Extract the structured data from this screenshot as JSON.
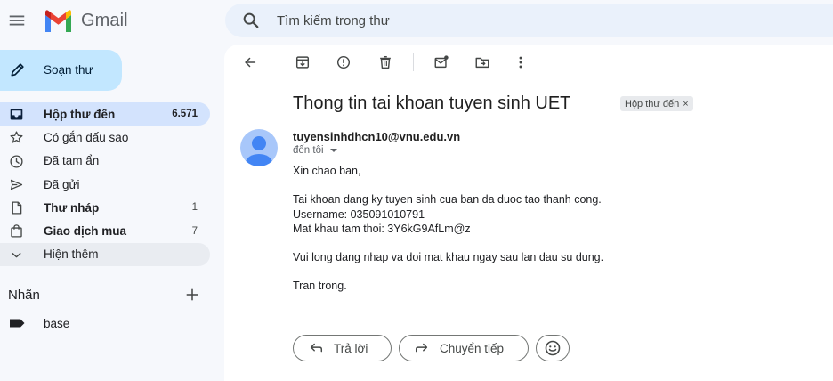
{
  "app": {
    "name": "Gmail"
  },
  "search": {
    "placeholder": "Tìm kiếm trong thư"
  },
  "compose": {
    "label": "Soạn thư"
  },
  "sidebar": {
    "items": [
      {
        "label": "Hộp thư đến",
        "count": "6.571",
        "icon": "inbox-icon"
      },
      {
        "label": "Có gắn dấu sao",
        "count": "",
        "icon": "star-icon"
      },
      {
        "label": "Đã tạm ẩn",
        "count": "",
        "icon": "clock-icon"
      },
      {
        "label": "Đã gửi",
        "count": "",
        "icon": "send-icon"
      },
      {
        "label": "Thư nháp",
        "count": "1",
        "icon": "draft-icon"
      },
      {
        "label": "Giao dịch mua",
        "count": "7",
        "icon": "shopping-bag-icon"
      },
      {
        "label": "Hiện thêm",
        "count": "",
        "icon": "chevron-down-icon"
      }
    ],
    "labels_title": "Nhãn",
    "labels": [
      {
        "name": "base"
      }
    ]
  },
  "email": {
    "subject": "Thong tin tai khoan tuyen sinh UET",
    "folder_chip": "Hộp thư đến",
    "chip_close": "×",
    "sender": "tuyensinhdhcn10@vnu.edu.vn",
    "recipient": "đến tôi",
    "body": [
      "Xin chao ban,",
      "Tai khoan dang ky tuyen sinh cua ban da duoc tao thanh cong.",
      "Username: 035091010791",
      "Mat khau tam thoi: 3Y6kG9AfLm@z",
      "Vui long dang nhap va doi mat khau ngay sau lan dau su dung.",
      "Tran trong."
    ]
  },
  "actions": {
    "reply": "Trả lời",
    "forward": "Chuyển tiếp"
  },
  "colors": {
    "accent": "#c2e7ff",
    "active_nav": "#d3e3fd",
    "search_bg": "#eaf1fb",
    "avatar": "#a8c7fa"
  }
}
